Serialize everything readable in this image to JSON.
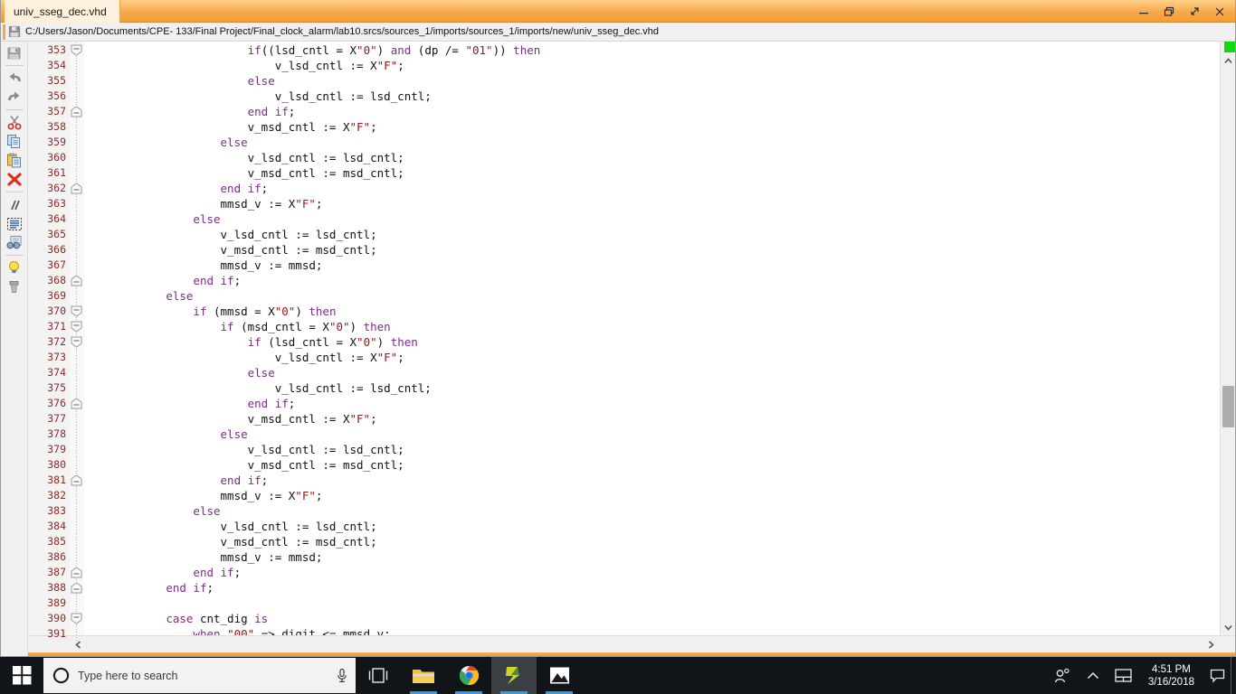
{
  "window": {
    "tab_label": "univ_sseg_dec.vhd",
    "path": "C:/Users/Jason/Documents/CPE- 133/Final Project/Final_clock_alarm/lab10.srcs/sources_1/imports/sources_1/imports/new/univ_sseg_dec.vhd",
    "buttons": {
      "minimize": "—",
      "restore": "❐",
      "maximize": "↗",
      "close": "✕"
    },
    "titlebar_color": "#f5a64b",
    "tab_color": "#fdf0dd"
  },
  "left_toolbar": {
    "items": [
      {
        "name": "save-icon",
        "title": "Save File"
      },
      {
        "name": "undo-icon",
        "title": "Undo"
      },
      {
        "name": "redo-icon",
        "title": "Redo"
      },
      {
        "name": "cut-icon",
        "title": "Cut"
      },
      {
        "name": "copy-icon",
        "title": "Copy"
      },
      {
        "name": "paste-icon",
        "title": "Paste"
      },
      {
        "name": "delete-icon",
        "title": "Delete"
      },
      {
        "name": "comment-icon",
        "title": "Toggle Comment"
      },
      {
        "name": "select-all-icon",
        "title": "Select All"
      },
      {
        "name": "find-replace-icon",
        "title": "Find / Replace"
      },
      {
        "name": "lightbulb-icon",
        "title": "Hints"
      },
      {
        "name": "theme-icon",
        "title": "Editor Options"
      }
    ]
  },
  "editor": {
    "first_line": 353,
    "gutter_color": "#8f2a2a",
    "scroll": {
      "vertical_thumb_top_pct": 58,
      "vertical_thumb_height_pct": 7,
      "marker_color": "#12d90f"
    },
    "lines": [
      {
        "n": 353,
        "fold": "start",
        "tokens": [
          {
            "t": "                        ",
            "c": "pl"
          },
          {
            "t": "if",
            "c": "kw"
          },
          {
            "t": "((lsd_cntl = X",
            "c": "pl"
          },
          {
            "t": "\"0\"",
            "c": "str"
          },
          {
            "t": ") ",
            "c": "pl"
          },
          {
            "t": "and",
            "c": "kw"
          },
          {
            "t": " (dp /= ",
            "c": "pl"
          },
          {
            "t": "\"01\"",
            "c": "str"
          },
          {
            "t": ")) ",
            "c": "pl"
          },
          {
            "t": "then",
            "c": "kw"
          }
        ]
      },
      {
        "n": 354,
        "fold": "",
        "tokens": [
          {
            "t": "                            v_lsd_cntl := X",
            "c": "pl"
          },
          {
            "t": "\"F\"",
            "c": "str"
          },
          {
            "t": ";",
            "c": "pl"
          }
        ]
      },
      {
        "n": 355,
        "fold": "",
        "tokens": [
          {
            "t": "                        ",
            "c": "pl"
          },
          {
            "t": "else",
            "c": "kw"
          }
        ]
      },
      {
        "n": 356,
        "fold": "",
        "tokens": [
          {
            "t": "                            v_lsd_cntl := lsd_cntl;",
            "c": "pl"
          }
        ]
      },
      {
        "n": 357,
        "fold": "end",
        "tokens": [
          {
            "t": "                        ",
            "c": "pl"
          },
          {
            "t": "end if",
            "c": "kw"
          },
          {
            "t": ";",
            "c": "pl"
          }
        ]
      },
      {
        "n": 358,
        "fold": "",
        "tokens": [
          {
            "t": "                        v_msd_cntl := X",
            "c": "pl"
          },
          {
            "t": "\"F\"",
            "c": "str"
          },
          {
            "t": ";",
            "c": "pl"
          }
        ]
      },
      {
        "n": 359,
        "fold": "",
        "tokens": [
          {
            "t": "                    ",
            "c": "pl"
          },
          {
            "t": "else",
            "c": "kw"
          }
        ]
      },
      {
        "n": 360,
        "fold": "",
        "tokens": [
          {
            "t": "                        v_lsd_cntl := lsd_cntl;",
            "c": "pl"
          }
        ]
      },
      {
        "n": 361,
        "fold": "",
        "tokens": [
          {
            "t": "                        v_msd_cntl := msd_cntl;",
            "c": "pl"
          }
        ]
      },
      {
        "n": 362,
        "fold": "end",
        "tokens": [
          {
            "t": "                    ",
            "c": "pl"
          },
          {
            "t": "end if",
            "c": "kw"
          },
          {
            "t": ";",
            "c": "pl"
          }
        ]
      },
      {
        "n": 363,
        "fold": "",
        "tokens": [
          {
            "t": "                    mmsd_v := X",
            "c": "pl"
          },
          {
            "t": "\"F\"",
            "c": "str"
          },
          {
            "t": ";",
            "c": "pl"
          }
        ]
      },
      {
        "n": 364,
        "fold": "",
        "tokens": [
          {
            "t": "                ",
            "c": "pl"
          },
          {
            "t": "else",
            "c": "kw"
          }
        ]
      },
      {
        "n": 365,
        "fold": "",
        "tokens": [
          {
            "t": "                    v_lsd_cntl := lsd_cntl;",
            "c": "pl"
          }
        ]
      },
      {
        "n": 366,
        "fold": "",
        "tokens": [
          {
            "t": "                    v_msd_cntl := msd_cntl;",
            "c": "pl"
          }
        ]
      },
      {
        "n": 367,
        "fold": "",
        "tokens": [
          {
            "t": "                    mmsd_v := mmsd;",
            "c": "pl"
          }
        ]
      },
      {
        "n": 368,
        "fold": "end",
        "tokens": [
          {
            "t": "                ",
            "c": "pl"
          },
          {
            "t": "end if",
            "c": "kw"
          },
          {
            "t": ";",
            "c": "pl"
          }
        ]
      },
      {
        "n": 369,
        "fold": "",
        "tokens": [
          {
            "t": "            ",
            "c": "pl"
          },
          {
            "t": "else",
            "c": "kw"
          }
        ]
      },
      {
        "n": 370,
        "fold": "start",
        "tokens": [
          {
            "t": "                ",
            "c": "pl"
          },
          {
            "t": "if",
            "c": "kw"
          },
          {
            "t": " (mmsd = X",
            "c": "pl"
          },
          {
            "t": "\"0\"",
            "c": "str"
          },
          {
            "t": ") ",
            "c": "pl"
          },
          {
            "t": "then",
            "c": "kw"
          }
        ]
      },
      {
        "n": 371,
        "fold": "start",
        "tokens": [
          {
            "t": "                    ",
            "c": "pl"
          },
          {
            "t": "if",
            "c": "kw"
          },
          {
            "t": " (msd_cntl = X",
            "c": "pl"
          },
          {
            "t": "\"0\"",
            "c": "str"
          },
          {
            "t": ") ",
            "c": "pl"
          },
          {
            "t": "then",
            "c": "kw"
          }
        ]
      },
      {
        "n": 372,
        "fold": "start",
        "tokens": [
          {
            "t": "                        ",
            "c": "pl"
          },
          {
            "t": "if",
            "c": "kw"
          },
          {
            "t": " (lsd_cntl = X",
            "c": "pl"
          },
          {
            "t": "\"0\"",
            "c": "str"
          },
          {
            "t": ") ",
            "c": "pl"
          },
          {
            "t": "then",
            "c": "kw"
          }
        ]
      },
      {
        "n": 373,
        "fold": "",
        "tokens": [
          {
            "t": "                            v_lsd_cntl := X",
            "c": "pl"
          },
          {
            "t": "\"F\"",
            "c": "str"
          },
          {
            "t": ";",
            "c": "pl"
          }
        ]
      },
      {
        "n": 374,
        "fold": "",
        "tokens": [
          {
            "t": "                        ",
            "c": "pl"
          },
          {
            "t": "else",
            "c": "kw"
          }
        ]
      },
      {
        "n": 375,
        "fold": "",
        "tokens": [
          {
            "t": "                            v_lsd_cntl := lsd_cntl;",
            "c": "pl"
          }
        ]
      },
      {
        "n": 376,
        "fold": "end",
        "tokens": [
          {
            "t": "                        ",
            "c": "pl"
          },
          {
            "t": "end if",
            "c": "kw"
          },
          {
            "t": ";",
            "c": "pl"
          }
        ]
      },
      {
        "n": 377,
        "fold": "",
        "tokens": [
          {
            "t": "                        v_msd_cntl := X",
            "c": "pl"
          },
          {
            "t": "\"F\"",
            "c": "str"
          },
          {
            "t": ";",
            "c": "pl"
          }
        ]
      },
      {
        "n": 378,
        "fold": "",
        "tokens": [
          {
            "t": "                    ",
            "c": "pl"
          },
          {
            "t": "else",
            "c": "kw"
          }
        ]
      },
      {
        "n": 379,
        "fold": "",
        "tokens": [
          {
            "t": "                        v_lsd_cntl := lsd_cntl;",
            "c": "pl"
          }
        ]
      },
      {
        "n": 380,
        "fold": "",
        "tokens": [
          {
            "t": "                        v_msd_cntl := msd_cntl;",
            "c": "pl"
          }
        ]
      },
      {
        "n": 381,
        "fold": "end",
        "tokens": [
          {
            "t": "                    ",
            "c": "pl"
          },
          {
            "t": "end if",
            "c": "kw"
          },
          {
            "t": ";",
            "c": "pl"
          }
        ]
      },
      {
        "n": 382,
        "fold": "",
        "tokens": [
          {
            "t": "                    mmsd_v := X",
            "c": "pl"
          },
          {
            "t": "\"F\"",
            "c": "str"
          },
          {
            "t": ";",
            "c": "pl"
          }
        ]
      },
      {
        "n": 383,
        "fold": "",
        "tokens": [
          {
            "t": "                ",
            "c": "pl"
          },
          {
            "t": "else",
            "c": "kw"
          }
        ]
      },
      {
        "n": 384,
        "fold": "",
        "tokens": [
          {
            "t": "                    v_lsd_cntl := lsd_cntl;",
            "c": "pl"
          }
        ]
      },
      {
        "n": 385,
        "fold": "",
        "tokens": [
          {
            "t": "                    v_msd_cntl := msd_cntl;",
            "c": "pl"
          }
        ]
      },
      {
        "n": 386,
        "fold": "",
        "tokens": [
          {
            "t": "                    mmsd_v := mmsd;",
            "c": "pl"
          }
        ]
      },
      {
        "n": 387,
        "fold": "end",
        "tokens": [
          {
            "t": "                ",
            "c": "pl"
          },
          {
            "t": "end if",
            "c": "kw"
          },
          {
            "t": ";",
            "c": "pl"
          }
        ]
      },
      {
        "n": 388,
        "fold": "end",
        "tokens": [
          {
            "t": "            ",
            "c": "pl"
          },
          {
            "t": "end if",
            "c": "kw"
          },
          {
            "t": ";",
            "c": "pl"
          }
        ]
      },
      {
        "n": 389,
        "fold": "",
        "tokens": [
          {
            "t": "",
            "c": "pl"
          }
        ]
      },
      {
        "n": 390,
        "fold": "start",
        "tokens": [
          {
            "t": "            ",
            "c": "pl"
          },
          {
            "t": "case",
            "c": "kw"
          },
          {
            "t": " cnt_dig ",
            "c": "pl"
          },
          {
            "t": "is",
            "c": "kw"
          }
        ]
      },
      {
        "n": 391,
        "fold": "",
        "tokens": [
          {
            "t": "                ",
            "c": "pl"
          },
          {
            "t": "when",
            "c": "kw"
          },
          {
            "t": " ",
            "c": "pl"
          },
          {
            "t": "\"00\"",
            "c": "str"
          },
          {
            "t": " => digit <= mmsd_v;",
            "c": "pl"
          }
        ]
      }
    ]
  },
  "taskbar": {
    "start_label": "Start",
    "search_placeholder": "Type here to search",
    "icons": [
      {
        "name": "task-view-icon",
        "label": "Task View",
        "active": false,
        "running": false
      },
      {
        "name": "file-explorer-icon",
        "label": "File Explorer",
        "active": false,
        "running": true
      },
      {
        "name": "chrome-icon",
        "label": "Google Chrome",
        "active": false,
        "running": true
      },
      {
        "name": "vivado-icon",
        "label": "Vivado",
        "active": true,
        "running": true
      },
      {
        "name": "photos-icon",
        "label": "Photos",
        "active": false,
        "running": true
      }
    ],
    "tray": [
      {
        "name": "people-icon",
        "label": "People"
      },
      {
        "name": "show-hidden-icons-icon",
        "label": "Show hidden icons"
      },
      {
        "name": "touchpad-icon",
        "label": "Touchpad settings"
      }
    ],
    "clock": {
      "time": "4:51 PM",
      "date": "3/16/2018"
    },
    "notification": {
      "name": "action-center-icon",
      "label": "Notifications"
    },
    "accent_color": "#3a9ad9"
  }
}
